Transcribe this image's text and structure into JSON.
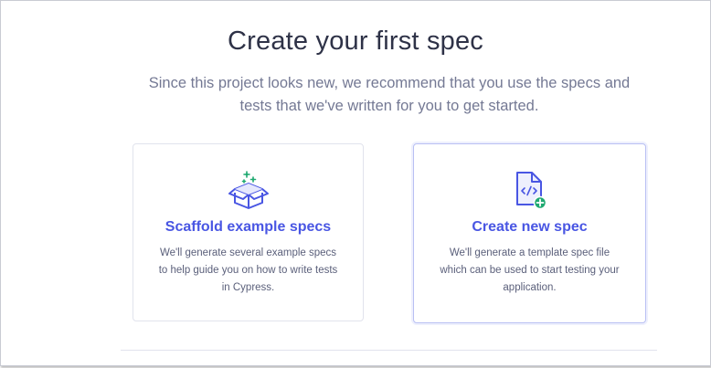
{
  "header": {
    "title": "Create your first spec",
    "subtitle": "Since this project looks new, we recommend that you use the specs and tests that we've written for you to get started."
  },
  "cards": [
    {
      "title": "Scaffold example specs",
      "description": "We'll generate several example specs to help guide you on how to write tests in Cypress.",
      "icon": "box-icon"
    },
    {
      "title": "Create new spec",
      "description": "We'll generate a template spec file which can be used to start testing your application.",
      "icon": "new-file-icon"
    }
  ],
  "colors": {
    "title_text": "#2e3247",
    "subtitle_text": "#747994",
    "card_title": "#4956e3",
    "accent_green": "#1fa971",
    "selected_border": "#b9c0f3"
  }
}
